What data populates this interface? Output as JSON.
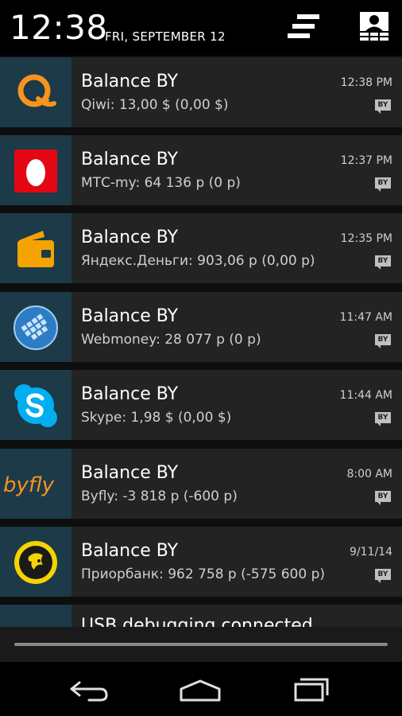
{
  "status": {
    "time": "12:38",
    "date": "FRI, SEPTEMBER 12"
  },
  "notifications": [
    {
      "app": "Qiwi",
      "icon": "qiwi-icon",
      "title": "Balance BY",
      "text": "Qiwi: 13,00 $ (0,00 $)",
      "time": "12:38 PM",
      "badge": "BY"
    },
    {
      "app": "MTC",
      "icon": "mts-icon",
      "title": "Balance BY",
      "text": "МТС-my: 64 136 р (0 р)",
      "time": "12:37 PM",
      "badge": "BY"
    },
    {
      "app": "Yandex",
      "icon": "yandex-money-icon",
      "title": "Balance BY",
      "text": "Яндекс.Деньги: 903,06 р (0,00 р)",
      "time": "12:35 PM",
      "badge": "BY"
    },
    {
      "app": "Webmoney",
      "icon": "webmoney-icon",
      "title": "Balance BY",
      "text": "Webmoney: 28 077 р (0 р)",
      "time": "11:47 AM",
      "badge": "BY"
    },
    {
      "app": "Skype",
      "icon": "skype-icon",
      "title": "Balance BY",
      "text": "Skype: 1,98 $ (0,00 $)",
      "time": "11:44 AM",
      "badge": "BY"
    },
    {
      "app": "Byfly",
      "icon": "byfly-icon",
      "title": "Balance BY",
      "text": "Byfly: -3 818 р (-600 р)",
      "time": "8:00 AM",
      "badge": "BY"
    },
    {
      "app": "Priorbank",
      "icon": "priorbank-icon",
      "title": "Balance BY",
      "text": "Приорбанк: 962 758 р (-575 600 р)",
      "time": "9/11/14",
      "badge": "BY"
    }
  ],
  "usb": {
    "title": "USB debugging connected"
  },
  "logo_text": {
    "byfly": "byfly"
  },
  "colors": {
    "icon_bg": "#1c3a48",
    "card_bg": "#232323",
    "qiwi": "#f7941d",
    "mts": "#e30613",
    "yandex": "#f5a300",
    "webmoney": "#0b5fa5",
    "skype": "#00aff0",
    "priorbank": "#f5d300"
  }
}
